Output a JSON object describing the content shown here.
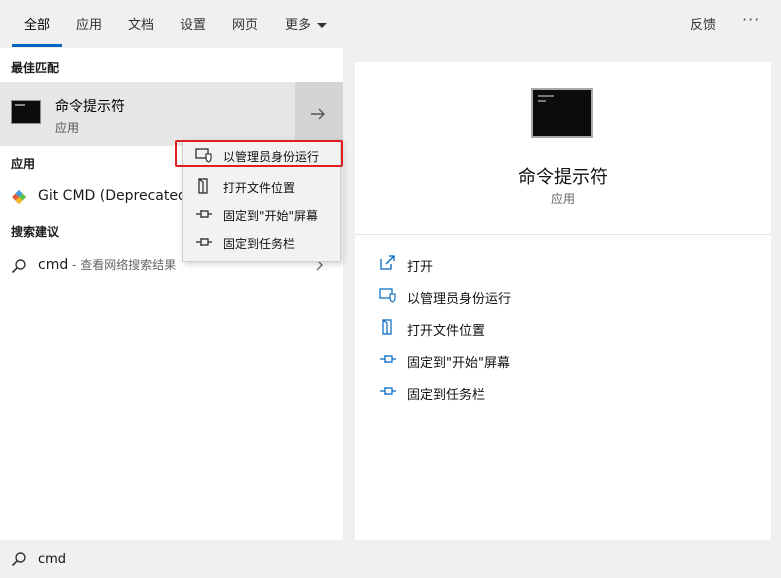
{
  "tabs": [
    "全部",
    "应用",
    "文档",
    "设置",
    "网页",
    "更多"
  ],
  "feedback": "反馈",
  "more_dots": "···",
  "left": {
    "best_match_header": "最佳匹配",
    "best_match_title": "命令提示符",
    "best_match_sub": "应用",
    "apps_header": "应用",
    "git_cmd": "Git CMD (Deprecated)",
    "suggest_header": "搜索建议",
    "suggest_query": "cmd",
    "suggest_hint": " - 查看网络搜索结果"
  },
  "context_menu": [
    "以管理员身份运行",
    "打开文件位置",
    "固定到\"开始\"屏幕",
    "固定到任务栏"
  ],
  "right": {
    "title": "命令提示符",
    "sub": "应用",
    "actions": [
      "打开",
      "以管理员身份运行",
      "打开文件位置",
      "固定到\"开始\"屏幕",
      "固定到任务栏"
    ]
  },
  "search": {
    "query": "cmd"
  },
  "colors": {
    "accent": "#0067c0",
    "highlight": "#e02020",
    "icon_blue": "#0067c0"
  },
  "icons": [
    "cmd-icon",
    "arrow-right-icon",
    "git-icon",
    "search-icon",
    "chevron-right-icon",
    "shield-icon",
    "folder-icon",
    "pin-icon",
    "open-icon"
  ]
}
